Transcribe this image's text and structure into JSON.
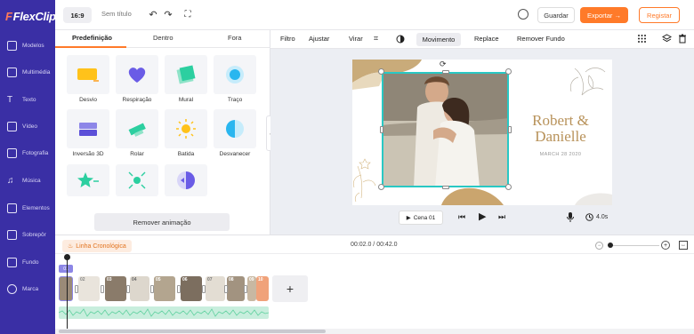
{
  "app": {
    "logo": "FlexClip"
  },
  "sidebar": {
    "items": [
      {
        "label": "Modelos",
        "icon": "templates-icon"
      },
      {
        "label": "Multimédia",
        "icon": "media-icon"
      },
      {
        "label": "Texto",
        "icon": "text-icon"
      },
      {
        "label": "Vídeo",
        "icon": "video-icon"
      },
      {
        "label": "Fotografia",
        "icon": "photo-icon"
      },
      {
        "label": "Música",
        "icon": "music-icon"
      },
      {
        "label": "Elementos",
        "icon": "elements-icon"
      },
      {
        "label": "Sobrepôr",
        "icon": "overlay-icon"
      },
      {
        "label": "Fundo",
        "icon": "background-icon"
      },
      {
        "label": "Marca",
        "icon": "brand-icon"
      }
    ]
  },
  "topbar": {
    "ratio": "16:9",
    "title_placeholder": "Sem título",
    "save": "Guardar",
    "export": "Exportar →",
    "register": "Registar"
  },
  "panel": {
    "tabs": [
      "Predefinição",
      "Dentro",
      "Fora"
    ],
    "animations": [
      {
        "label": "Desvio"
      },
      {
        "label": "Respiração"
      },
      {
        "label": "Mural"
      },
      {
        "label": "Traço"
      },
      {
        "label": "Inversão 3D"
      },
      {
        "label": "Rolar"
      },
      {
        "label": "Batida"
      },
      {
        "label": "Desvanecer"
      },
      {
        "label": ""
      },
      {
        "label": ""
      },
      {
        "label": ""
      }
    ],
    "remove": "Remover animação"
  },
  "toolbar": {
    "filter": "Filtro",
    "adjust": "Ajustar",
    "flip": "Virar",
    "motion": "Movimento",
    "replace": "Replace",
    "remove_bg": "Remover Fundo"
  },
  "canvas": {
    "title_line1": "Robert &",
    "title_line2": "Danielle",
    "date": "MARCH 28 2020"
  },
  "playbar": {
    "scene": "Cena 01",
    "duration": "4.0s"
  },
  "timeline": {
    "label": "Linha Cronológica",
    "time": "00:02.0 / 00:42.0",
    "marker": "01",
    "clip_numbers": [
      "",
      "02",
      "03",
      "04",
      "05",
      "06",
      "07",
      "08",
      "09",
      "10"
    ]
  },
  "colors": {
    "sidebar": "#3a2fa5",
    "accent": "#ff7a29",
    "selection": "#29c8c4",
    "audio": "#c8eedd"
  }
}
